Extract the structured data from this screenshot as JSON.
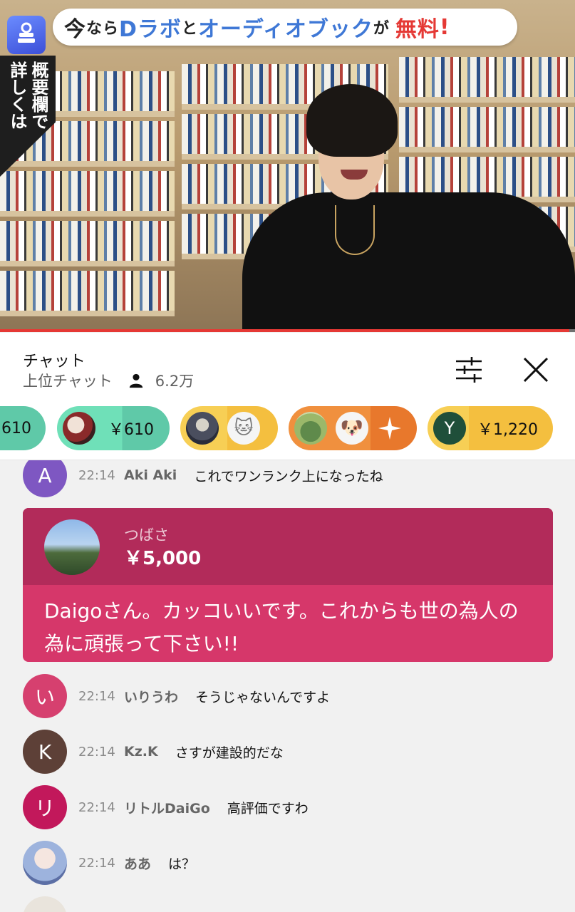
{
  "video": {
    "banner": {
      "p1": "今",
      "p2": "なら",
      "p3": "Dラボ",
      "p4": "と",
      "p5": "オーディオブック",
      "p6": "が",
      "p7": "無料",
      "p8": "!"
    },
    "vertical_text": {
      "col1": "詳しくは",
      "col2": "概要欄で"
    },
    "progress": 0.99,
    "colors": {
      "progress": "#e53935"
    }
  },
  "chat_header": {
    "title": "チャット",
    "mode": "上位チャット",
    "viewers": "6.2万"
  },
  "tickers": [
    {
      "amount": "610",
      "color": "#5fc9a8"
    },
    {
      "amount": "￥610",
      "color": "#5fc9a8"
    },
    {
      "amount": "",
      "color": "#f4bf3f"
    },
    {
      "amount": "",
      "color": "#e8782c"
    },
    {
      "avatar_letter": "Y",
      "amount": "￥1,220",
      "color": "#f4bf3f"
    }
  ],
  "messages": [
    {
      "avatar": "A",
      "avatar_color": "#7e57c2",
      "time": "22:14",
      "author": "Aki Aki",
      "text": "これでワンランク上になったね"
    },
    {
      "avatar": "い",
      "avatar_color": "#d6406f",
      "time": "22:14",
      "author": "いりうわ",
      "text": "そうじゃないんですよ"
    },
    {
      "avatar": "K",
      "avatar_color": "#5d4037",
      "time": "22:14",
      "author": "Kz.K",
      "text": "さすが建設的だな"
    },
    {
      "avatar": "リ",
      "avatar_color": "#c2185b",
      "time": "22:14",
      "author": "リトルDaiGo",
      "text": "高評価ですわ"
    },
    {
      "avatar": "",
      "avatar_color": "#c7d6ee",
      "time": "22:14",
      "author": "ああ",
      "text": "は？"
    }
  ],
  "superchat": {
    "name": "つばさ",
    "amount": "￥5,000",
    "message": "Daigoさん。カッコいいです。これからも世の為人の為に頑張って下さい!!",
    "colors": {
      "header": "#b22b5a",
      "body": "#d6376a"
    }
  }
}
